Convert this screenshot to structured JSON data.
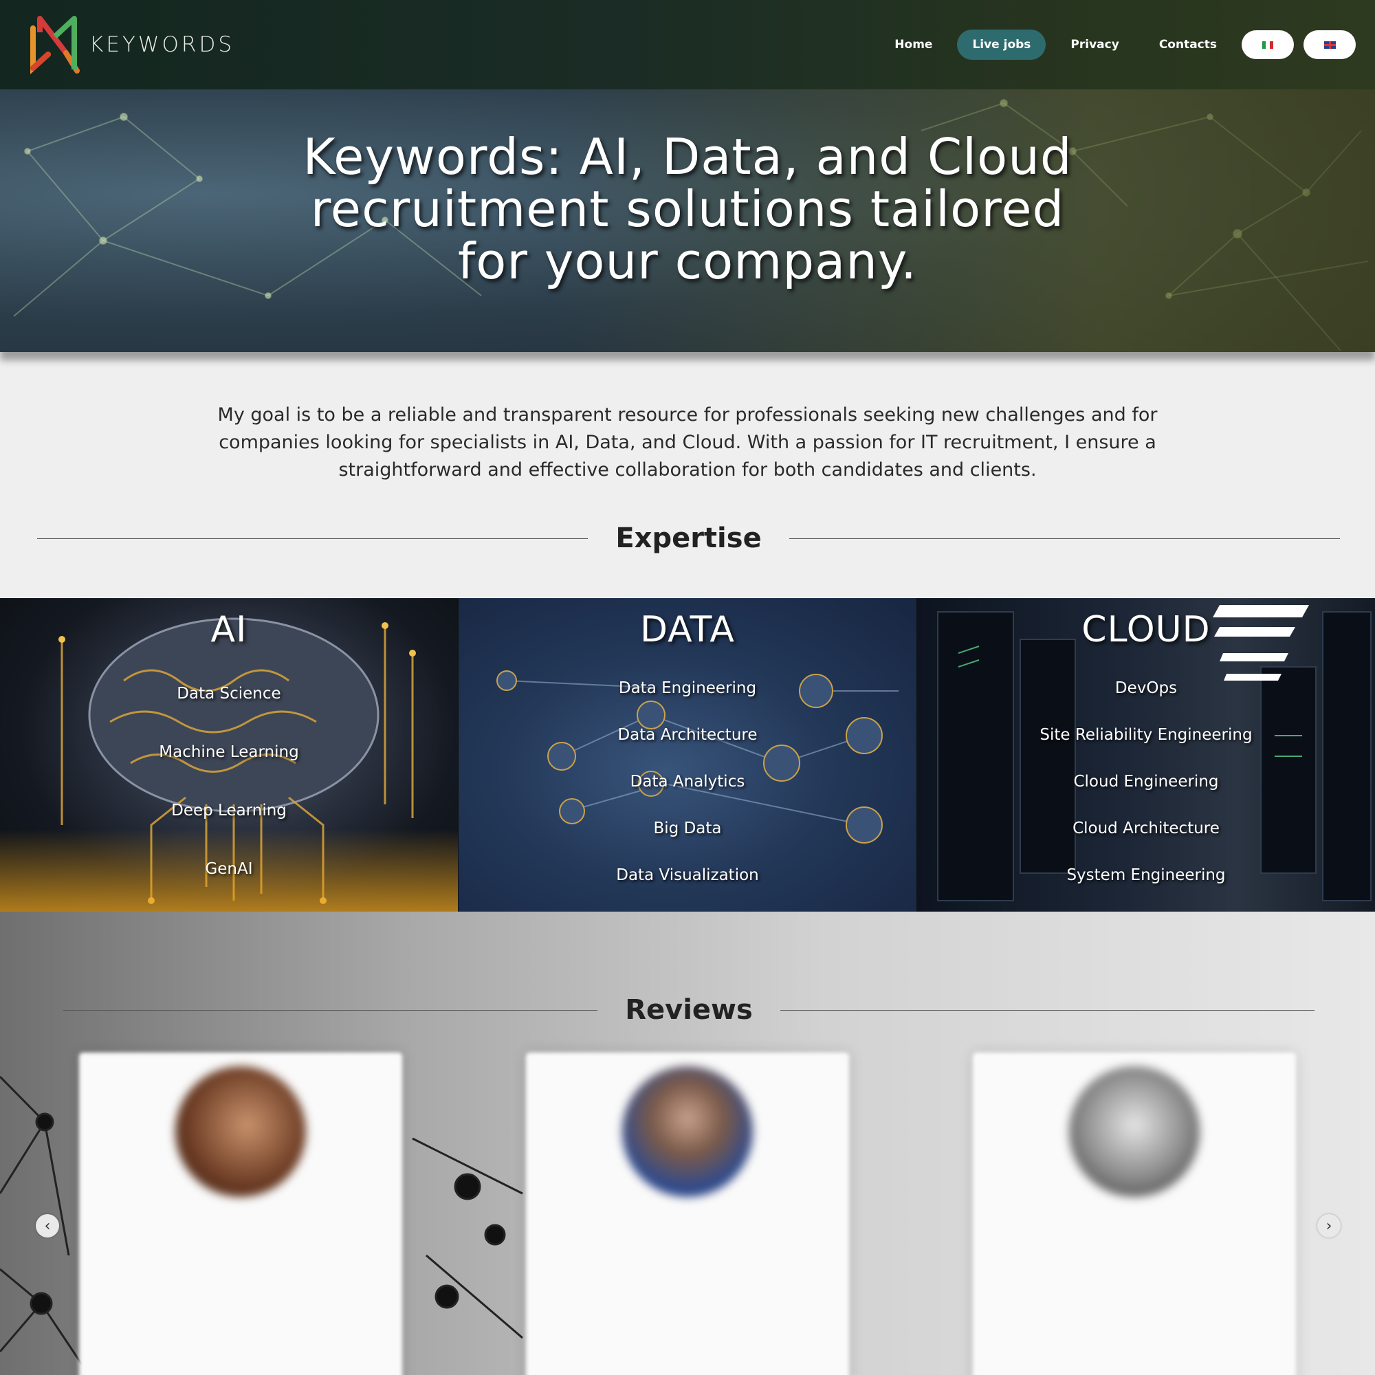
{
  "nav": {
    "brand": "KEYWORDS",
    "links": [
      {
        "label": "Home"
      },
      {
        "label": "Live jobs"
      },
      {
        "label": "Privacy"
      },
      {
        "label": "Contacts"
      }
    ],
    "active_link": "Live jobs",
    "languages": [
      "it-flag-icon",
      "uk-flag-icon"
    ]
  },
  "hero": {
    "title": "Keywords: AI, Data, and Cloud recruitment solutions tailored for your company."
  },
  "intro": {
    "text": "My goal is to be a reliable and transparent resource for professionals seeking new challenges and for companies looking for specialists in AI, Data, and Cloud. With a passion for IT recruitment, I ensure a straightforward and effective collaboration for both candidates and clients."
  },
  "expertise": {
    "heading": "Expertise",
    "cards": [
      {
        "title": "AI",
        "items": [
          "Data Science",
          "Machine Learning",
          "Deep Learning",
          "GenAI"
        ]
      },
      {
        "title": "DATA",
        "items": [
          "Data Engineering",
          "Data Architecture",
          "Data Analytics",
          "Big Data",
          "Data Visualization"
        ]
      },
      {
        "title": "CLOUD",
        "items": [
          "DevOps",
          "Site Reliability Engineering",
          "Cloud Engineering",
          "Cloud Architecture",
          "System Engineering"
        ]
      }
    ]
  },
  "reviews": {
    "heading": "Reviews",
    "prev_icon": "chevron-left-icon",
    "next_icon": "chevron-right-icon",
    "items": [
      {
        "name": "",
        "role": "",
        "text": ""
      },
      {
        "name": "",
        "role": "",
        "text": ""
      },
      {
        "name": "",
        "role": "",
        "text": ""
      }
    ]
  },
  "colors": {
    "nav_bg": "#1a2c25",
    "active_pill": "#2e6b6e",
    "page_bg": "#efefef"
  }
}
